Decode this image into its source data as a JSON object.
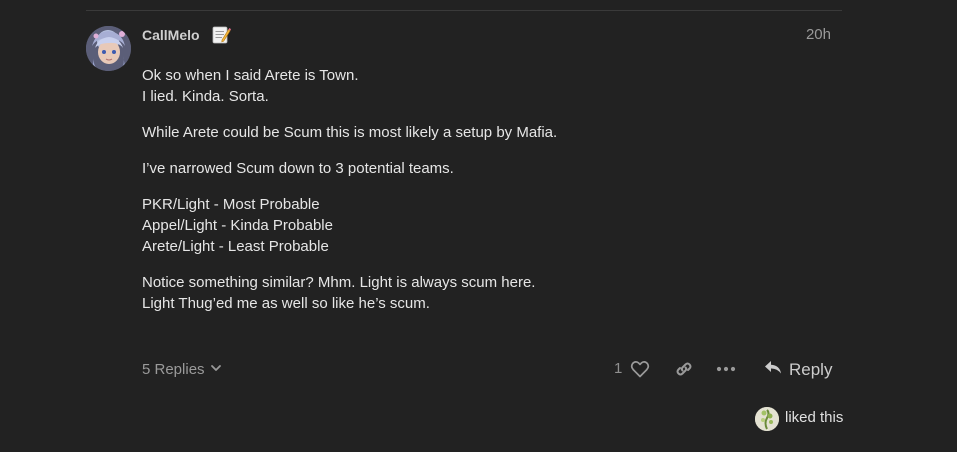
{
  "post": {
    "username": "CallMelo",
    "user_badge_icon": "memo-icon",
    "date": "20h",
    "paragraphs": [
      [
        "Ok so when I said Arete is Town.",
        "I lied. Kinda. Sorta."
      ],
      [
        "While Arete could be Scum this is most likely a setup by Mafia."
      ],
      [
        "I’ve narrowed Scum down to 3 potential teams."
      ],
      [
        "PKR/Light - Most Probable",
        "Appel/Light - Kinda Probable",
        "Arete/Light - Least Probable"
      ],
      [
        "Notice something similar? Mhm. Light is always scum here.",
        "Light Thug’ed me as well so like he’s scum."
      ]
    ]
  },
  "controls": {
    "replies_label": "5 Replies",
    "like_count": "1",
    "reply_label": "Reply"
  },
  "likes": {
    "text": "liked this"
  },
  "colors": {
    "background": "#222222",
    "text": "#e6e6e6",
    "muted": "#9a9a9a"
  }
}
